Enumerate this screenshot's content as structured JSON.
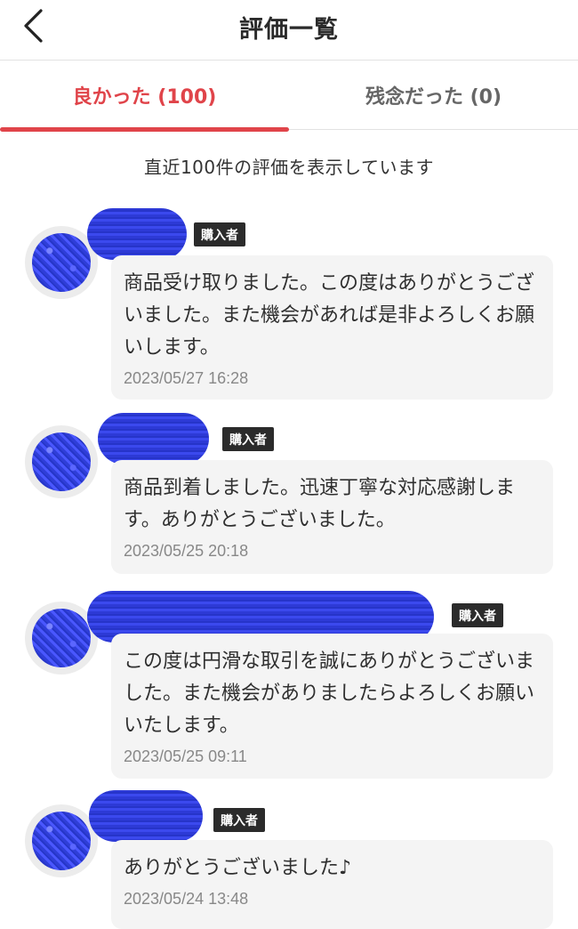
{
  "header": {
    "title": "評価一覧",
    "back_icon": "chevron-left-icon"
  },
  "tabs": [
    {
      "label": "良かった (100)",
      "active": true
    },
    {
      "label": "残念だった (0)",
      "active": false
    }
  ],
  "notice": "直近100件の評価を表示しています",
  "colors": {
    "accent": "#e0444a",
    "badge": "#2b2b2b",
    "bubble": "#f4f4f4"
  },
  "reviews": [
    {
      "badge": "購入者",
      "text": "商品受け取りました。この度はありがとうございました。また機会があれば是非よろしくお願いします。",
      "date": "2023/05/27 16:28"
    },
    {
      "badge": "購入者",
      "text": "商品到着しました。迅速丁寧な対応感謝します。ありがとうございました。",
      "date": "2023/05/25 20:18"
    },
    {
      "badge": "購入者",
      "text": "この度は円滑な取引を誠にありがとうございました。また機会がありましたらよろしくお願いいたします。",
      "date": "2023/05/25 09:11"
    },
    {
      "badge": "購入者",
      "text": "ありがとうございました♪",
      "date": "2023/05/24 13:48"
    }
  ]
}
